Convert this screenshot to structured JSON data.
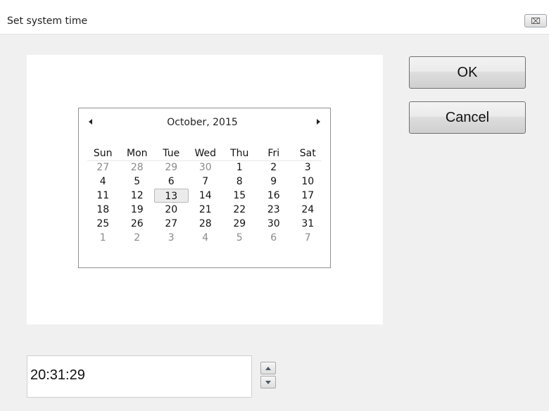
{
  "window": {
    "title": "Set system time",
    "close_glyph": "⌧"
  },
  "calendar": {
    "month_label": "October, 2015",
    "weekday_headers": [
      "Sun",
      "Mon",
      "Tue",
      "Wed",
      "Thu",
      "Fri",
      "Sat"
    ],
    "weeks": [
      [
        "27",
        "28",
        "29",
        "30",
        "1",
        "2",
        "3"
      ],
      [
        "4",
        "5",
        "6",
        "7",
        "8",
        "9",
        "10"
      ],
      [
        "11",
        "12",
        "13",
        "14",
        "15",
        "16",
        "17"
      ],
      [
        "18",
        "19",
        "20",
        "21",
        "22",
        "23",
        "24"
      ],
      [
        "25",
        "26",
        "27",
        "28",
        "29",
        "30",
        "31"
      ],
      [
        "1",
        "2",
        "3",
        "4",
        "5",
        "6",
        "7"
      ]
    ],
    "selected_day": "13",
    "other_month_marks": {
      "first_week_count": 4,
      "last_week_count": 7
    }
  },
  "buttons": {
    "ok_label": "OK",
    "cancel_label": "Cancel"
  },
  "time": {
    "value": "20:31:29"
  }
}
